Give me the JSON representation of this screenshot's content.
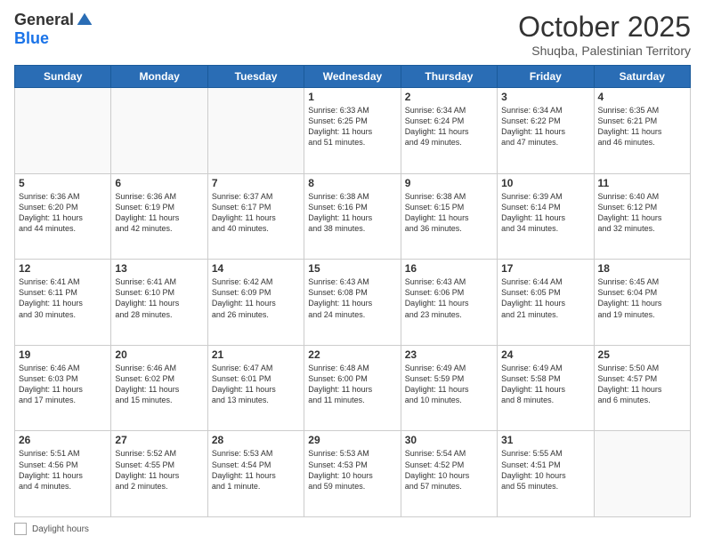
{
  "logo": {
    "general": "General",
    "blue": "Blue"
  },
  "title": "October 2025",
  "location": "Shuqba, Palestinian Territory",
  "weekdays": [
    "Sunday",
    "Monday",
    "Tuesday",
    "Wednesday",
    "Thursday",
    "Friday",
    "Saturday"
  ],
  "footer": {
    "daylight_label": "Daylight hours"
  },
  "weeks": [
    [
      {
        "day": "",
        "info": ""
      },
      {
        "day": "",
        "info": ""
      },
      {
        "day": "",
        "info": ""
      },
      {
        "day": "1",
        "info": "Sunrise: 6:33 AM\nSunset: 6:25 PM\nDaylight: 11 hours\nand 51 minutes."
      },
      {
        "day": "2",
        "info": "Sunrise: 6:34 AM\nSunset: 6:24 PM\nDaylight: 11 hours\nand 49 minutes."
      },
      {
        "day": "3",
        "info": "Sunrise: 6:34 AM\nSunset: 6:22 PM\nDaylight: 11 hours\nand 47 minutes."
      },
      {
        "day": "4",
        "info": "Sunrise: 6:35 AM\nSunset: 6:21 PM\nDaylight: 11 hours\nand 46 minutes."
      }
    ],
    [
      {
        "day": "5",
        "info": "Sunrise: 6:36 AM\nSunset: 6:20 PM\nDaylight: 11 hours\nand 44 minutes."
      },
      {
        "day": "6",
        "info": "Sunrise: 6:36 AM\nSunset: 6:19 PM\nDaylight: 11 hours\nand 42 minutes."
      },
      {
        "day": "7",
        "info": "Sunrise: 6:37 AM\nSunset: 6:17 PM\nDaylight: 11 hours\nand 40 minutes."
      },
      {
        "day": "8",
        "info": "Sunrise: 6:38 AM\nSunset: 6:16 PM\nDaylight: 11 hours\nand 38 minutes."
      },
      {
        "day": "9",
        "info": "Sunrise: 6:38 AM\nSunset: 6:15 PM\nDaylight: 11 hours\nand 36 minutes."
      },
      {
        "day": "10",
        "info": "Sunrise: 6:39 AM\nSunset: 6:14 PM\nDaylight: 11 hours\nand 34 minutes."
      },
      {
        "day": "11",
        "info": "Sunrise: 6:40 AM\nSunset: 6:12 PM\nDaylight: 11 hours\nand 32 minutes."
      }
    ],
    [
      {
        "day": "12",
        "info": "Sunrise: 6:41 AM\nSunset: 6:11 PM\nDaylight: 11 hours\nand 30 minutes."
      },
      {
        "day": "13",
        "info": "Sunrise: 6:41 AM\nSunset: 6:10 PM\nDaylight: 11 hours\nand 28 minutes."
      },
      {
        "day": "14",
        "info": "Sunrise: 6:42 AM\nSunset: 6:09 PM\nDaylight: 11 hours\nand 26 minutes."
      },
      {
        "day": "15",
        "info": "Sunrise: 6:43 AM\nSunset: 6:08 PM\nDaylight: 11 hours\nand 24 minutes."
      },
      {
        "day": "16",
        "info": "Sunrise: 6:43 AM\nSunset: 6:06 PM\nDaylight: 11 hours\nand 23 minutes."
      },
      {
        "day": "17",
        "info": "Sunrise: 6:44 AM\nSunset: 6:05 PM\nDaylight: 11 hours\nand 21 minutes."
      },
      {
        "day": "18",
        "info": "Sunrise: 6:45 AM\nSunset: 6:04 PM\nDaylight: 11 hours\nand 19 minutes."
      }
    ],
    [
      {
        "day": "19",
        "info": "Sunrise: 6:46 AM\nSunset: 6:03 PM\nDaylight: 11 hours\nand 17 minutes."
      },
      {
        "day": "20",
        "info": "Sunrise: 6:46 AM\nSunset: 6:02 PM\nDaylight: 11 hours\nand 15 minutes."
      },
      {
        "day": "21",
        "info": "Sunrise: 6:47 AM\nSunset: 6:01 PM\nDaylight: 11 hours\nand 13 minutes."
      },
      {
        "day": "22",
        "info": "Sunrise: 6:48 AM\nSunset: 6:00 PM\nDaylight: 11 hours\nand 11 minutes."
      },
      {
        "day": "23",
        "info": "Sunrise: 6:49 AM\nSunset: 5:59 PM\nDaylight: 11 hours\nand 10 minutes."
      },
      {
        "day": "24",
        "info": "Sunrise: 6:49 AM\nSunset: 5:58 PM\nDaylight: 11 hours\nand 8 minutes."
      },
      {
        "day": "25",
        "info": "Sunrise: 5:50 AM\nSunset: 4:57 PM\nDaylight: 11 hours\nand 6 minutes."
      }
    ],
    [
      {
        "day": "26",
        "info": "Sunrise: 5:51 AM\nSunset: 4:56 PM\nDaylight: 11 hours\nand 4 minutes."
      },
      {
        "day": "27",
        "info": "Sunrise: 5:52 AM\nSunset: 4:55 PM\nDaylight: 11 hours\nand 2 minutes."
      },
      {
        "day": "28",
        "info": "Sunrise: 5:53 AM\nSunset: 4:54 PM\nDaylight: 11 hours\nand 1 minute."
      },
      {
        "day": "29",
        "info": "Sunrise: 5:53 AM\nSunset: 4:53 PM\nDaylight: 10 hours\nand 59 minutes."
      },
      {
        "day": "30",
        "info": "Sunrise: 5:54 AM\nSunset: 4:52 PM\nDaylight: 10 hours\nand 57 minutes."
      },
      {
        "day": "31",
        "info": "Sunrise: 5:55 AM\nSunset: 4:51 PM\nDaylight: 10 hours\nand 55 minutes."
      },
      {
        "day": "",
        "info": ""
      }
    ]
  ]
}
